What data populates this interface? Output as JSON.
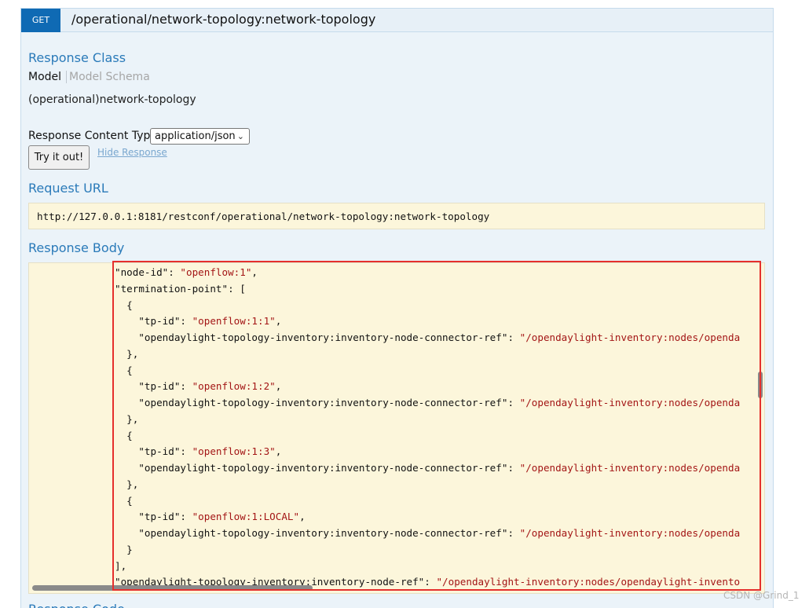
{
  "operation": {
    "method": "GET",
    "path": "/operational/network-topology:network-topology"
  },
  "response_class": {
    "title": "Response Class",
    "tabs": [
      "Model",
      "Model Schema"
    ],
    "model": "(operational)network-topology"
  },
  "content_type": {
    "label": "Response Content Type",
    "selected": "application/json"
  },
  "actions": {
    "try_label": "Try it out!",
    "hide_label": "Hide Response"
  },
  "request_url": {
    "title": "Request URL",
    "value": "http://127.0.0.1:8181/restconf/operational/network-topology:network-topology"
  },
  "response_body": {
    "title": "Response Body",
    "lines": [
      {
        "indent": "",
        "key": "\"node-id\"",
        "sep": ": ",
        "str": "\"openflow:1\"",
        "tail": ","
      },
      {
        "indent": "",
        "key": "\"termination-point\"",
        "sep": ": [",
        "str": "",
        "tail": ""
      },
      {
        "indent": "  ",
        "key": "{",
        "sep": "",
        "str": "",
        "tail": ""
      },
      {
        "indent": "    ",
        "key": "\"tp-id\"",
        "sep": ": ",
        "str": "\"openflow:1:1\"",
        "tail": ","
      },
      {
        "indent": "    ",
        "key": "\"opendaylight-topology-inventory:inventory-node-connector-ref\"",
        "sep": ": ",
        "str": "\"/opendaylight-inventory:nodes/openda",
        "tail": ""
      },
      {
        "indent": "  ",
        "key": "},",
        "sep": "",
        "str": "",
        "tail": ""
      },
      {
        "indent": "  ",
        "key": "{",
        "sep": "",
        "str": "",
        "tail": ""
      },
      {
        "indent": "    ",
        "key": "\"tp-id\"",
        "sep": ": ",
        "str": "\"openflow:1:2\"",
        "tail": ","
      },
      {
        "indent": "    ",
        "key": "\"opendaylight-topology-inventory:inventory-node-connector-ref\"",
        "sep": ": ",
        "str": "\"/opendaylight-inventory:nodes/openda",
        "tail": ""
      },
      {
        "indent": "  ",
        "key": "},",
        "sep": "",
        "str": "",
        "tail": ""
      },
      {
        "indent": "  ",
        "key": "{",
        "sep": "",
        "str": "",
        "tail": ""
      },
      {
        "indent": "    ",
        "key": "\"tp-id\"",
        "sep": ": ",
        "str": "\"openflow:1:3\"",
        "tail": ","
      },
      {
        "indent": "    ",
        "key": "\"opendaylight-topology-inventory:inventory-node-connector-ref\"",
        "sep": ": ",
        "str": "\"/opendaylight-inventory:nodes/openda",
        "tail": ""
      },
      {
        "indent": "  ",
        "key": "},",
        "sep": "",
        "str": "",
        "tail": ""
      },
      {
        "indent": "  ",
        "key": "{",
        "sep": "",
        "str": "",
        "tail": ""
      },
      {
        "indent": "    ",
        "key": "\"tp-id\"",
        "sep": ": ",
        "str": "\"openflow:1:LOCAL\"",
        "tail": ","
      },
      {
        "indent": "    ",
        "key": "\"opendaylight-topology-inventory:inventory-node-connector-ref\"",
        "sep": ": ",
        "str": "\"/opendaylight-inventory:nodes/openda",
        "tail": ""
      },
      {
        "indent": "  ",
        "key": "}",
        "sep": "",
        "str": "",
        "tail": ""
      },
      {
        "indent": "",
        "key": "],",
        "sep": "",
        "str": "",
        "tail": ""
      },
      {
        "indent": "",
        "key": "\"opendaylight-topology-inventory:inventory-node-ref\"",
        "sep": ": ",
        "str": "\"/opendaylight-inventory:nodes/opendaylight-invento",
        "tail": ""
      }
    ]
  },
  "next_section": {
    "title": "Response Code"
  },
  "watermark": "CSDN @Grind_1",
  "colors": {
    "method_badge": "#0f6ab4",
    "section_title": "#2a7ab9",
    "code_background": "#fcf6db",
    "json_string": "#a31515",
    "highlight_box": "#e5302d"
  }
}
